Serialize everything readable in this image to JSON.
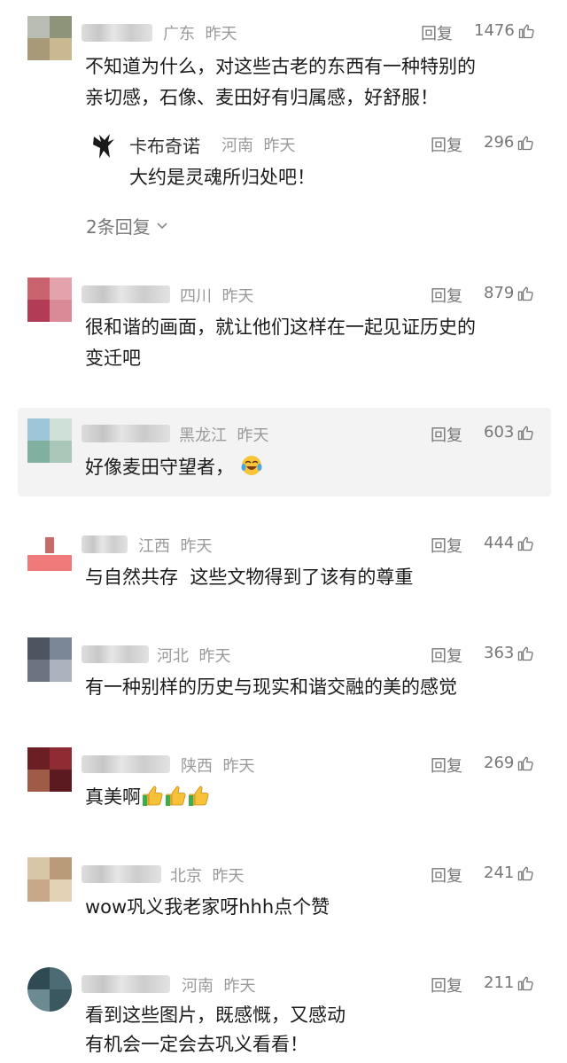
{
  "comments": [
    {
      "region": "广东",
      "time": "昨天",
      "reply_label": "回复",
      "likes": "1476",
      "lines": [
        "不知道为什么，对这些古老的东西有一种特别的",
        "亲切感，石像、麦田好有归属感，好舒服！"
      ],
      "sub_reply": {
        "name": "卡布奇诺",
        "region": "河南",
        "time": "昨天",
        "reply_label": "回复",
        "likes": "296",
        "text": "大约是灵魂所归处吧！"
      },
      "more_replies": "2条回复"
    },
    {
      "region": "四川",
      "time": "昨天",
      "reply_label": "回复",
      "likes": "879",
      "lines": [
        "很和谐的画面，就让他们这样在一起见证历史的",
        "变迁吧"
      ]
    },
    {
      "region": "黑龙江",
      "time": "昨天",
      "reply_label": "回复",
      "likes": "603",
      "lines": [
        "好像麦田守望者，"
      ],
      "emoji": "laughing-tears-emoji"
    },
    {
      "region": "江西",
      "time": "昨天",
      "reply_label": "回复",
      "likes": "444",
      "lines": [
        "与自然共存  这些文物得到了该有的尊重"
      ]
    },
    {
      "region": "河北",
      "time": "昨天",
      "reply_label": "回复",
      "likes": "363",
      "lines": [
        "有一种别样的历史与现实和谐交融的美的感觉"
      ]
    },
    {
      "region": "陕西",
      "time": "昨天",
      "reply_label": "回复",
      "likes": "269",
      "lines": [
        "真美啊"
      ],
      "emoji": "thumbs-up-emoji x3"
    },
    {
      "region": "北京",
      "time": "昨天",
      "reply_label": "回复",
      "likes": "241",
      "lines": [
        "wow巩义我老家呀hhh点个赞"
      ]
    },
    {
      "region": "河南",
      "time": "昨天",
      "reply_label": "回复",
      "likes": "211",
      "lines": [
        "看到这些图片，既感慨，又感动",
        "有机会一定会去巩义看看！"
      ]
    }
  ],
  "colors": {
    "meta_gray": "#9a9a9a",
    "action_gray": "#777777",
    "text": "#1b1b1b",
    "highlight_bg": "#f3f3f3"
  }
}
